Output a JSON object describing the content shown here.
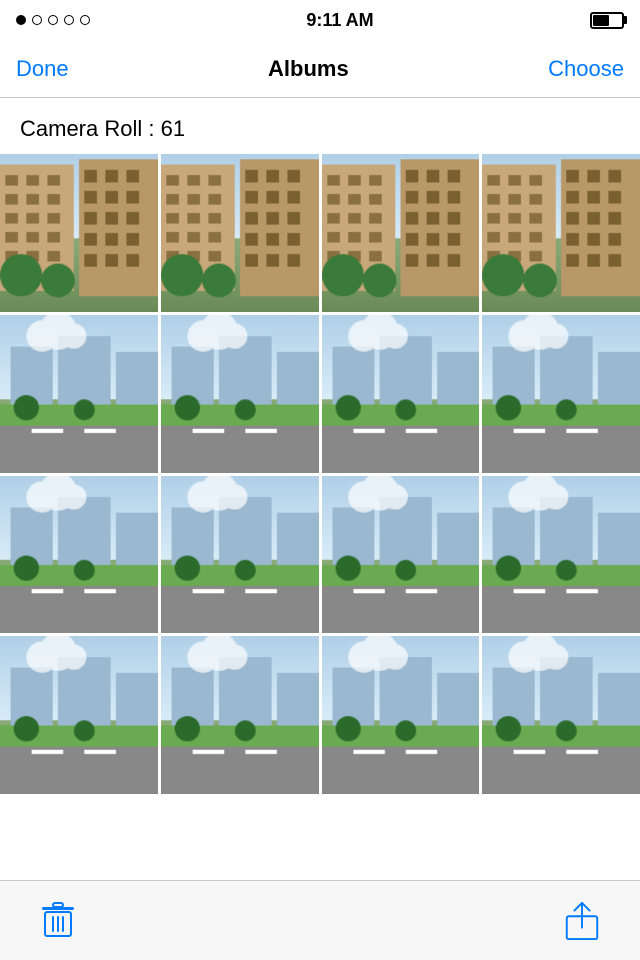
{
  "status_bar": {
    "time": "9:11 AM",
    "dots": [
      true,
      false,
      false,
      false,
      false
    ]
  },
  "nav": {
    "done_label": "Done",
    "title": "Albums",
    "choose_label": "Choose"
  },
  "album": {
    "name": "Camera Roll",
    "count": 61,
    "header": "Camera Roll : 61"
  },
  "photos": {
    "count": 16,
    "rows": 4,
    "cols": 4
  },
  "toolbar": {
    "trash_label": "Delete",
    "share_label": "Share"
  },
  "colors": {
    "accent": "#007aff",
    "nav_bg": "#ffffff",
    "status_bg": "#ffffff",
    "border": "#c8c8c8",
    "toolbar_bg": "#f7f7f7"
  }
}
